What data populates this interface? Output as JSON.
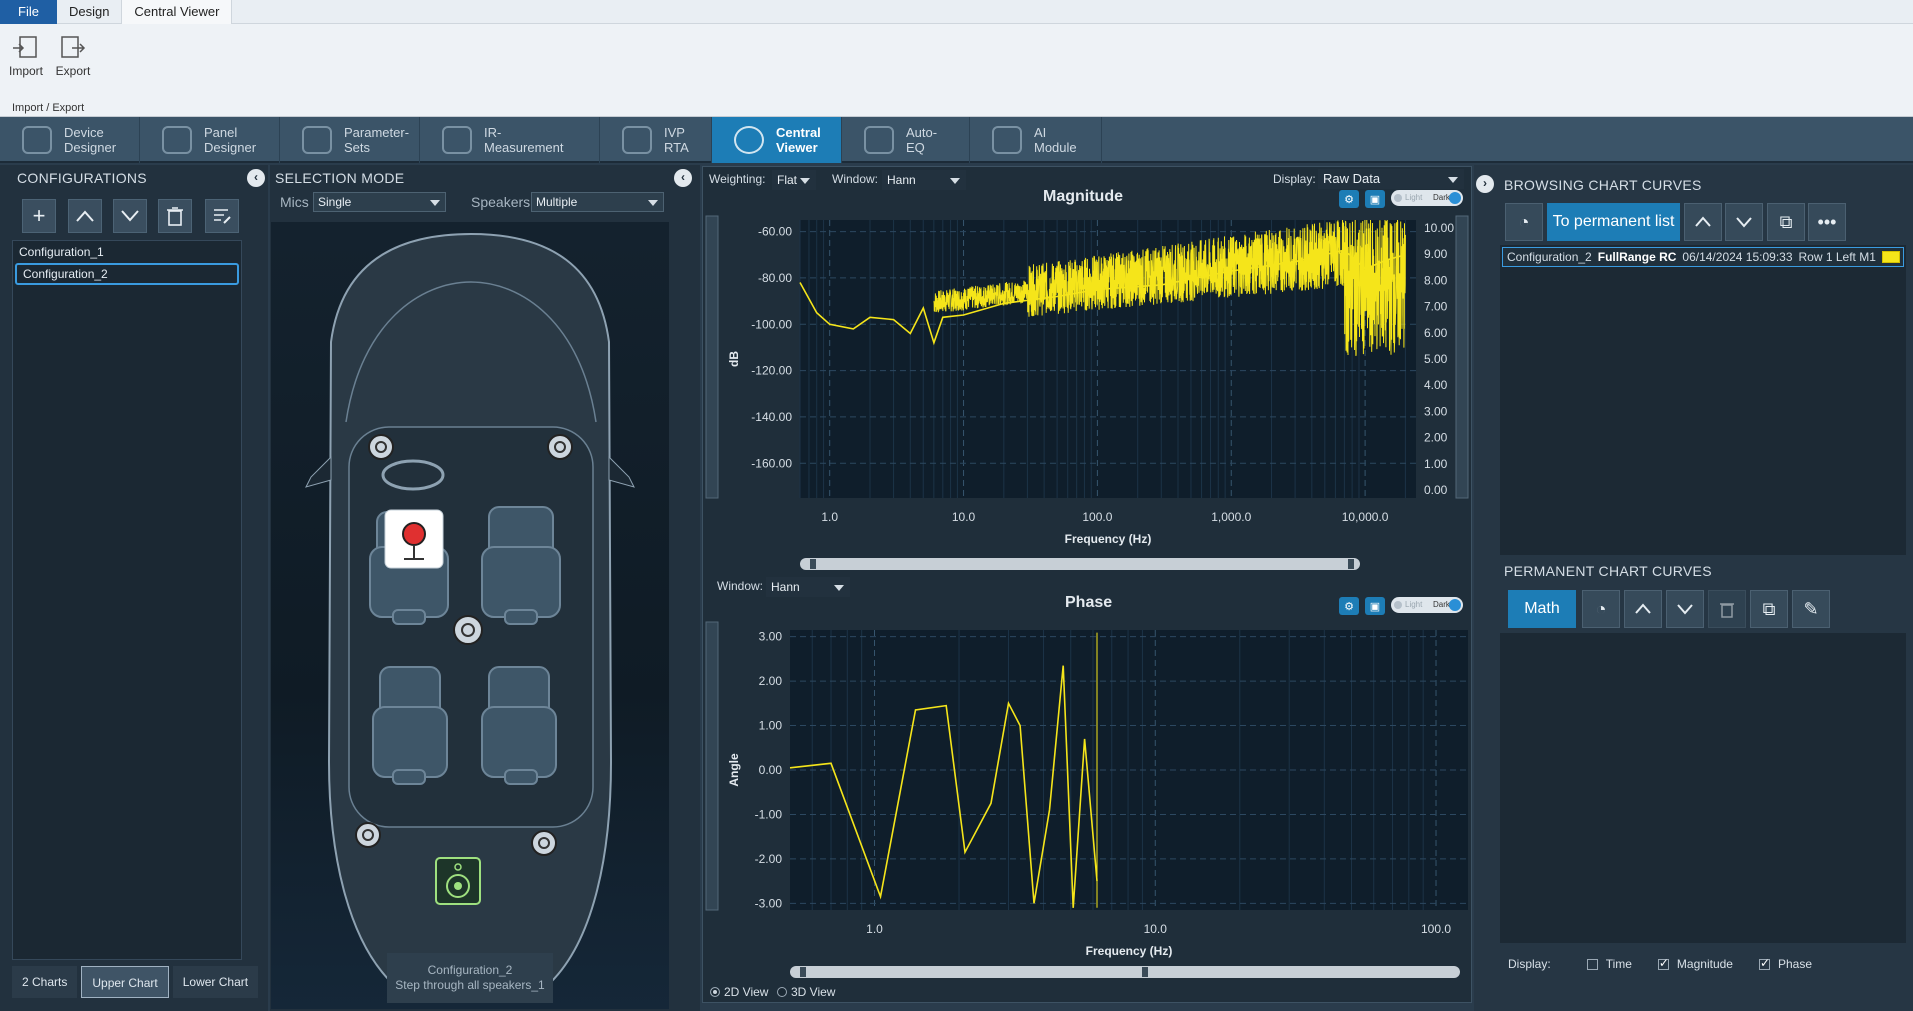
{
  "menu": {
    "file": "File",
    "design": "Design",
    "central_viewer": "Central Viewer"
  },
  "ribbon": {
    "import": "Import",
    "export": "Export",
    "group": "Import / Export"
  },
  "modules": [
    {
      "line1": "Device",
      "line2": "Designer"
    },
    {
      "line1": "Panel",
      "line2": "Designer"
    },
    {
      "line1": "Parameter-",
      "line2": "Sets"
    },
    {
      "line1": "IR-",
      "line2": "Measurement"
    },
    {
      "line1": "IVP",
      "line2": "RTA"
    },
    {
      "line1": "Central",
      "line2": "Viewer"
    },
    {
      "line1": "Auto-",
      "line2": "EQ"
    },
    {
      "line1": "AI",
      "line2": "Module"
    }
  ],
  "configurations": {
    "title": "CONFIGURATIONS",
    "items": [
      "Configuration_1",
      "Configuration_2"
    ],
    "selected": "Configuration_2"
  },
  "bottom_tabs": [
    "2 Charts",
    "Upper Chart",
    "Lower Chart"
  ],
  "selection": {
    "title": "SELECTION MODE",
    "mics_label": "Mics",
    "mics_value": "Single",
    "speakers_label": "Speakers",
    "speakers_value": "Multiple",
    "caption_line1": "Configuration_2",
    "caption_line2": "Step through all speakers_1"
  },
  "chart_controls": {
    "weighting_label": "Weighting:",
    "weighting_value": "Flat",
    "window_label": "Window:",
    "window_value": "Hann",
    "display_label": "Display:",
    "display_value": "Raw Data",
    "window2_label": "Window:",
    "window2_value": "Hann",
    "toggle_light": "Light",
    "toggle_dark": "Dark",
    "view_2d": "2D View",
    "view_3d": "3D View"
  },
  "chart_data": [
    {
      "type": "line",
      "title": "Magnitude",
      "xlabel": "Frequency (Hz)",
      "ylabel": "dB",
      "x_scale": "log",
      "x_ticks": [
        "1.0",
        "10.0",
        "100.0",
        "1,000.0",
        "10,000.0"
      ],
      "y_ticks": [
        "-60.00",
        "-80.00",
        "-100.00",
        "-120.00",
        "-140.00",
        "-160.00"
      ],
      "y2_ticks": [
        "10.00",
        "9.00",
        "8.00",
        "7.00",
        "6.00",
        "5.00",
        "4.00",
        "3.00",
        "2.00",
        "1.00",
        "0.00"
      ],
      "xlim": [
        0.6,
        24000
      ],
      "ylim": [
        -175,
        -55
      ],
      "series_color": "#f5e51a",
      "x": [
        0.6,
        0.8,
        1.0,
        1.5,
        2.0,
        3.0,
        4.0,
        5.0,
        6.0,
        7.0,
        10.0,
        20.0,
        50.0,
        100.0,
        300.0,
        1000.0,
        3000.0,
        7000.0,
        10000.0,
        15000.0,
        20000.0
      ],
      "y": [
        -82,
        -95,
        -100,
        -102,
        -97,
        -98,
        -104,
        -93,
        -108,
        -97,
        -96,
        -91,
        -88,
        -85,
        -83,
        -77,
        -73,
        -68,
        -76,
        -72,
        -70
      ]
    },
    {
      "type": "line",
      "title": "Phase",
      "xlabel": "Frequency (Hz)",
      "ylabel": "Angle",
      "x_scale": "log",
      "x_ticks": [
        "1.0",
        "10.0",
        "100.0"
      ],
      "y_ticks": [
        "3.00",
        "2.00",
        "1.00",
        "0.00",
        "-1.00",
        "-2.00",
        "-3.00"
      ],
      "xlim": [
        0.5,
        130
      ],
      "ylim": [
        -3.15,
        3.15
      ],
      "series_color": "#f5e51a",
      "x": [
        0.5,
        0.7,
        1.05,
        1.4,
        1.8,
        2.1,
        2.6,
        3.0,
        3.3,
        3.7,
        4.2,
        4.7,
        5.1,
        5.6,
        6.2
      ],
      "y": [
        0.05,
        0.15,
        -2.85,
        1.35,
        1.45,
        -1.85,
        -0.75,
        1.5,
        1.0,
        -3.0,
        -0.9,
        2.35,
        -3.1,
        0.7,
        -2.5
      ]
    }
  ],
  "browsing": {
    "title": "BROWSING CHART CURVES",
    "to_permanent": "To permanent list",
    "curve": {
      "config": "Configuration_2",
      "name": "FullRange RC",
      "date": "06/14/2024 15:09:33",
      "pos": "Row 1 Left M1",
      "color": "#f5e51a"
    }
  },
  "permanent": {
    "title": "PERMANENT CHART CURVES",
    "math": "Math"
  },
  "display": {
    "label": "Display:",
    "time": "Time",
    "magnitude": "Magnitude",
    "phase": "Phase"
  }
}
